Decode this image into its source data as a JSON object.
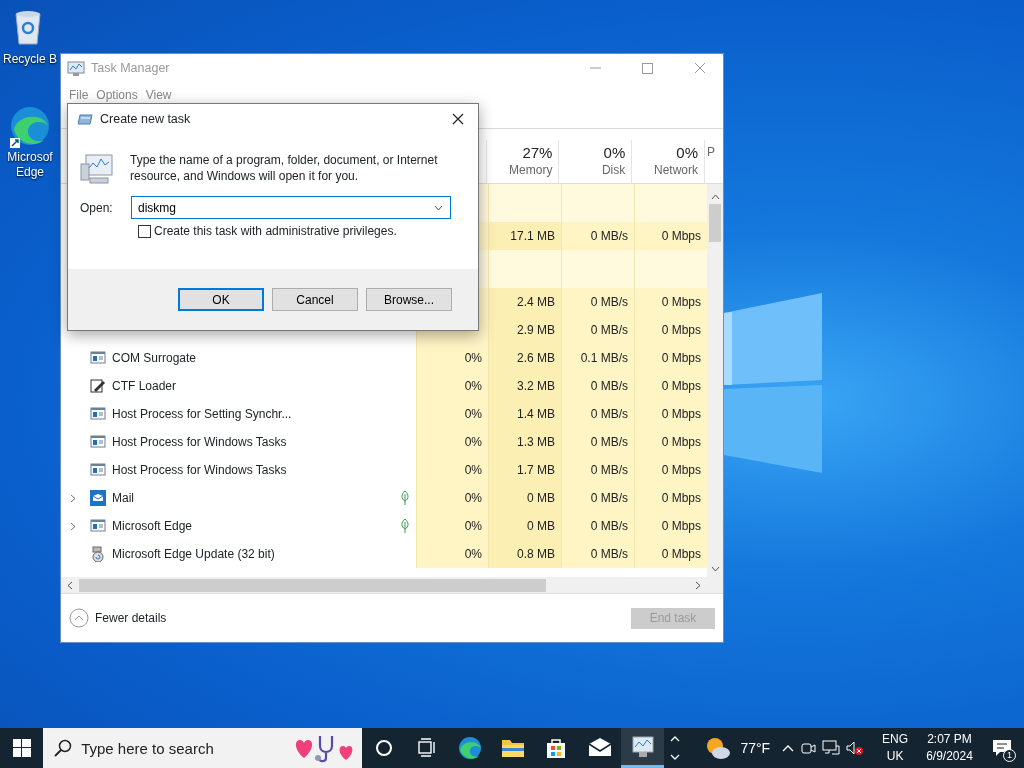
{
  "desktop": {
    "icons": [
      {
        "kind": "recycle",
        "lines": [
          "Recycle B"
        ]
      },
      {
        "kind": "edge",
        "lines": [
          "Microsof",
          "Edge"
        ]
      }
    ]
  },
  "task_manager": {
    "title": "Task Manager",
    "menu": [
      "File",
      "Options",
      "View"
    ],
    "columns": [
      {
        "value": "27%",
        "label": "Memory"
      },
      {
        "value": "0%",
        "label": "Disk"
      },
      {
        "value": "0%",
        "label": "Network"
      },
      {
        "label": "P"
      }
    ],
    "rows": [
      {
        "kind": "group"
      },
      {
        "kind": "covered",
        "memory": "17.1 MB",
        "disk": "0 MB/s",
        "network": "0 Mbps"
      },
      {
        "kind": "group"
      },
      {
        "kind": "covered",
        "memory": "2.4 MB",
        "disk": "0 MB/s",
        "network": "0 Mbps"
      },
      {
        "kind": "covered",
        "memory": "2.9 MB",
        "disk": "0 MB/s",
        "network": "0 Mbps"
      },
      {
        "kind": "service",
        "name": "COM Surrogate",
        "cpu": "0%",
        "memory": "2.6 MB",
        "disk": "0.1 MB/s",
        "network": "0 Mbps"
      },
      {
        "kind": "editor",
        "name": "CTF Loader",
        "cpu": "0%",
        "memory": "3.2 MB",
        "disk": "0 MB/s",
        "network": "0 Mbps"
      },
      {
        "kind": "service",
        "name": "Host Process for Setting Synchr...",
        "cpu": "0%",
        "memory": "1.4 MB",
        "disk": "0 MB/s",
        "network": "0 Mbps"
      },
      {
        "kind": "service",
        "name": "Host Process for Windows Tasks",
        "cpu": "0%",
        "memory": "1.3 MB",
        "disk": "0 MB/s",
        "network": "0 Mbps"
      },
      {
        "kind": "service",
        "name": "Host Process for Windows Tasks",
        "cpu": "0%",
        "memory": "1.7 MB",
        "disk": "0 MB/s",
        "network": "0 Mbps"
      },
      {
        "kind": "mail",
        "name": "Mail",
        "expandable": true,
        "suspended": true,
        "cpu": "0%",
        "memory": "0 MB",
        "disk": "0 MB/s",
        "network": "0 Mbps"
      },
      {
        "kind": "service",
        "name": "Microsoft Edge",
        "expandable": true,
        "suspended": true,
        "cpu": "0%",
        "memory": "0 MB",
        "disk": "0 MB/s",
        "network": "0 Mbps"
      },
      {
        "kind": "updater",
        "name": "Microsoft Edge Update (32 bit)",
        "cpu": "0%",
        "memory": "0.8 MB",
        "disk": "0 MB/s",
        "network": "0 Mbps"
      }
    ],
    "footer": {
      "toggle": "Fewer details",
      "end_task": {
        "label": "End task",
        "disabled": true
      }
    }
  },
  "dialog": {
    "title": "Create new task",
    "message": "Type the name of a program, folder, document, or Internet resource, and Windows will open it for you.",
    "open_label": "Open:",
    "open_value": "diskmg",
    "admin": {
      "label": "Create this task with administrative privileges.",
      "checked": false
    },
    "buttons": [
      {
        "label": "OK",
        "default": true
      },
      {
        "label": "Cancel",
        "default": false
      },
      {
        "label": "Browse...",
        "default": false
      }
    ]
  },
  "taskbar": {
    "search_placeholder": "Type here to search",
    "apps": [
      {
        "kind": "cortana",
        "active": false
      },
      {
        "kind": "taskview",
        "active": false
      },
      {
        "kind": "edge",
        "active": false
      },
      {
        "kind": "explorer",
        "active": false
      },
      {
        "kind": "store",
        "active": false
      },
      {
        "kind": "mail",
        "active": false
      },
      {
        "kind": "taskmanager",
        "active": true
      }
    ],
    "weather": "77°F",
    "language": [
      "ENG",
      "UK"
    ],
    "time": "2:07 PM",
    "date": "6/9/2024",
    "notifications": "1"
  }
}
